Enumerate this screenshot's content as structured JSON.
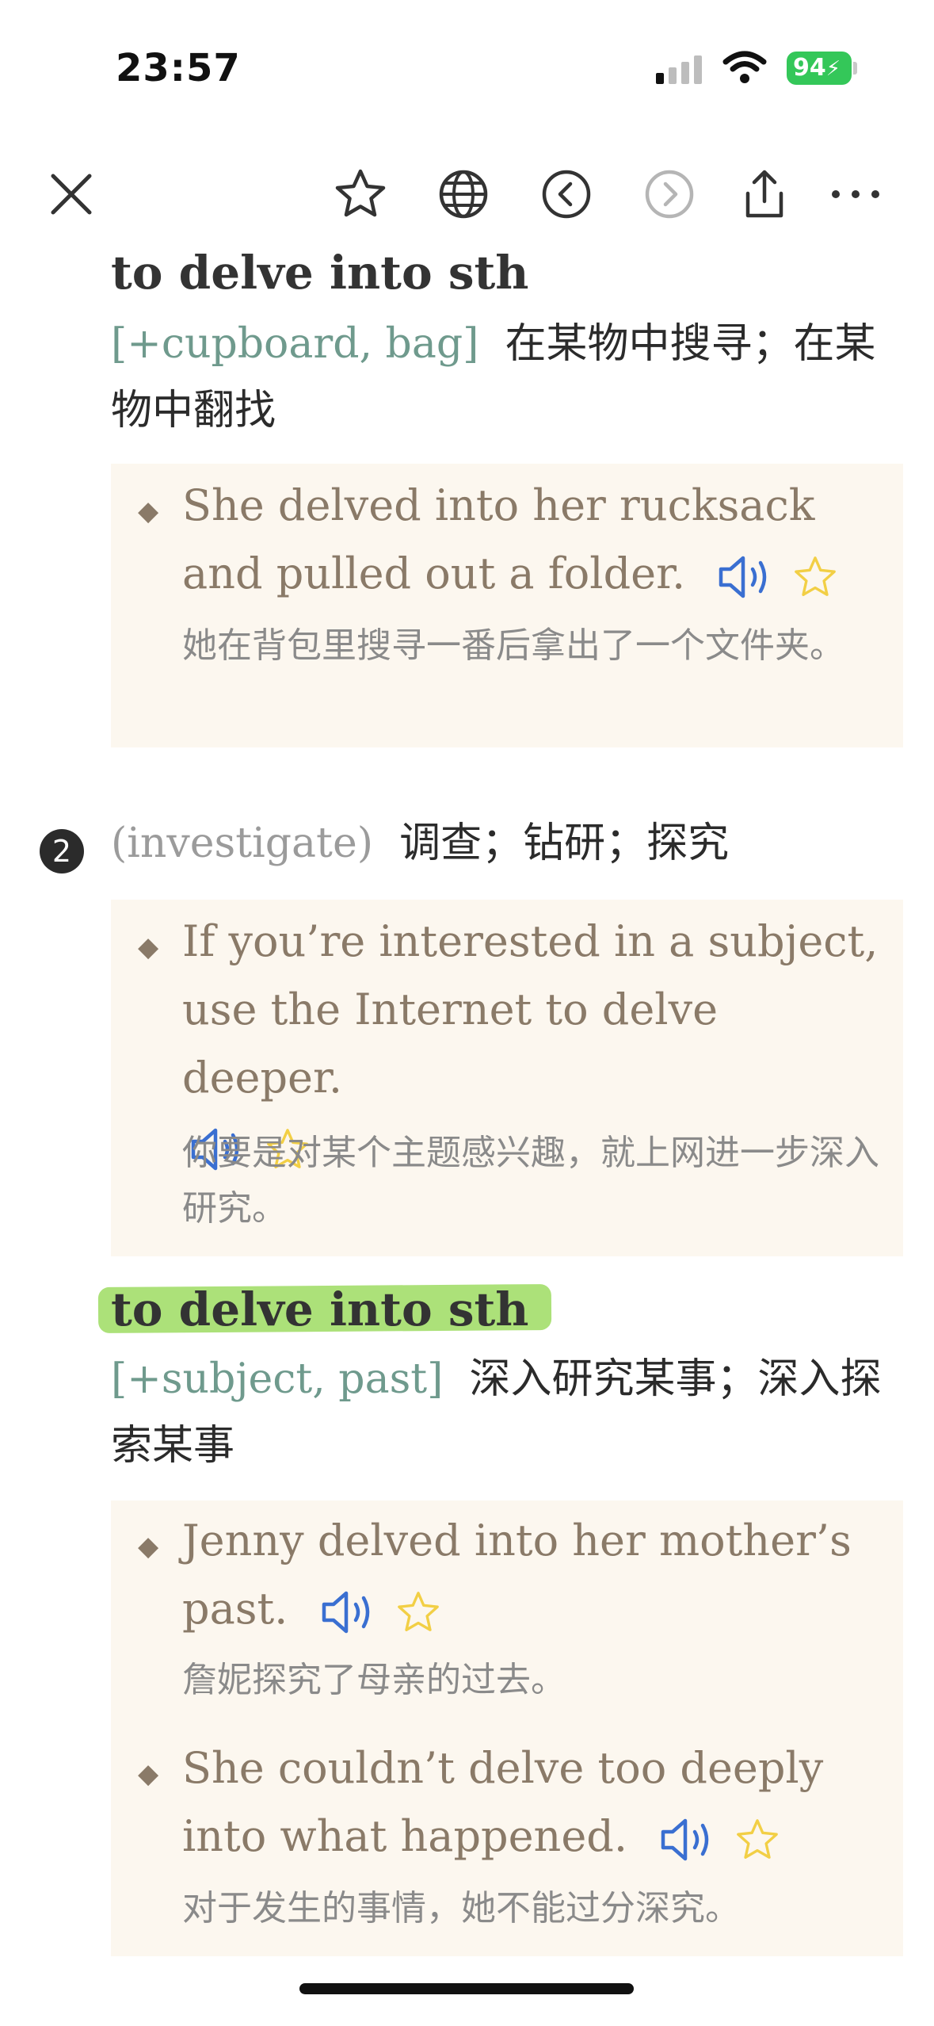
{
  "status_bar": {
    "time": "23:57",
    "battery": "94"
  },
  "toolbar": {
    "icons": [
      "close-icon",
      "star-icon",
      "globe-icon",
      "back-icon",
      "forward-icon",
      "share-icon",
      "more-icon"
    ]
  },
  "entry1": {
    "phrase": "to delve into sth",
    "grammar": "[+cupboard, bag]",
    "definition": "在某物中搜寻；在某物中翻找",
    "examples": [
      {
        "en": "She delved into her rucksack and pulled out a folder.",
        "zh": "她在背包里搜寻一番后拿出了一个文件夹。"
      }
    ]
  },
  "sense2": {
    "number": "2",
    "paren": "(investigate)",
    "definition": "调查；钻研；探究",
    "examples": [
      {
        "en": "If you’re interested in a subject, use the Internet to delve deeper.",
        "zh": "你要是对某个主题感兴趣，就上网进一步深入研究。"
      }
    ]
  },
  "entry2": {
    "phrase": "to delve into sth",
    "grammar": "[+subject, past]",
    "definition": "深入研究某事；深入探索某事",
    "examples": [
      {
        "en": "Jenny delved into her mother’s past.",
        "zh": "詹妮探究了母亲的过去。"
      },
      {
        "en": "She couldn’t delve too deeply into what happened.",
        "zh": "对于发生的事情，她不能过分深究。"
      }
    ]
  },
  "colors": {
    "grammar": "#6f9a8d",
    "example": "#8a7a68",
    "example_bg": "#fcf7ef",
    "highlight": "#a3de6a",
    "speaker": "#3a6fd1",
    "star": "#f2cf45"
  }
}
